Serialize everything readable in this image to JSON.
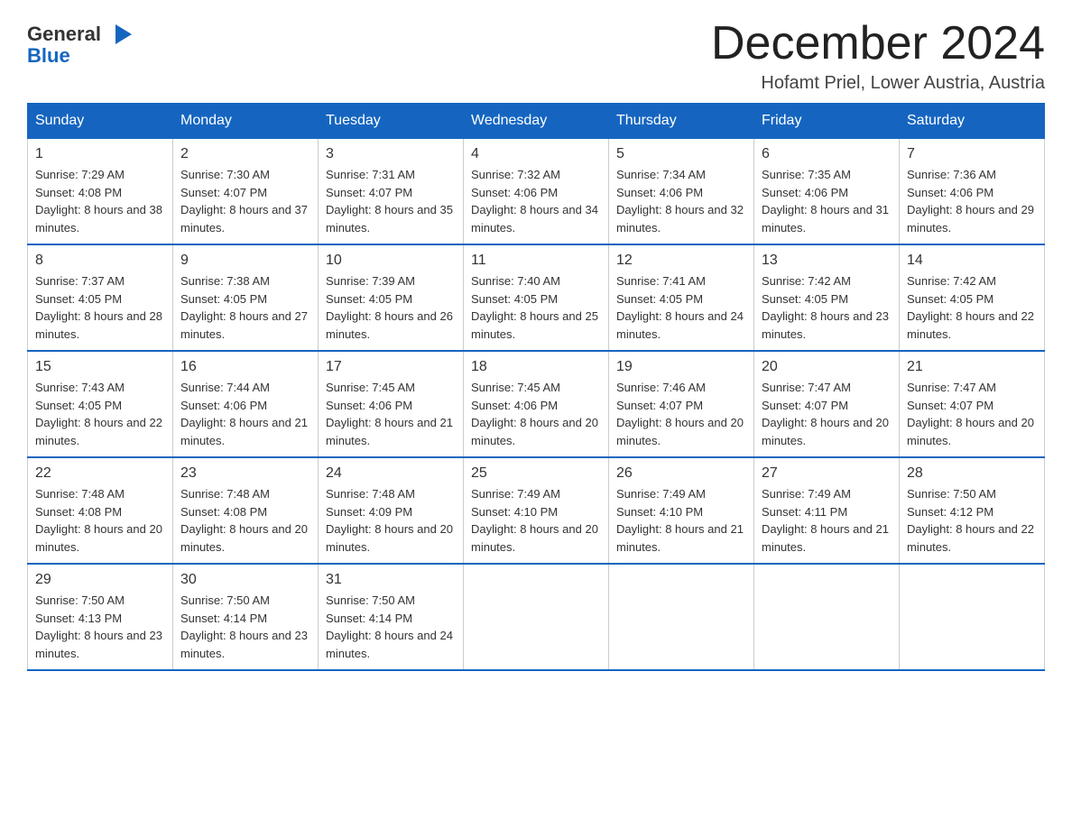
{
  "header": {
    "logo_line1": "General",
    "logo_line2": "Blue",
    "month_title": "December 2024",
    "location": "Hofamt Priel, Lower Austria, Austria"
  },
  "days_of_week": [
    "Sunday",
    "Monday",
    "Tuesday",
    "Wednesday",
    "Thursday",
    "Friday",
    "Saturday"
  ],
  "weeks": [
    [
      {
        "day": "1",
        "sunrise": "7:29 AM",
        "sunset": "4:08 PM",
        "daylight": "8 hours and 38 minutes."
      },
      {
        "day": "2",
        "sunrise": "7:30 AM",
        "sunset": "4:07 PM",
        "daylight": "8 hours and 37 minutes."
      },
      {
        "day": "3",
        "sunrise": "7:31 AM",
        "sunset": "4:07 PM",
        "daylight": "8 hours and 35 minutes."
      },
      {
        "day": "4",
        "sunrise": "7:32 AM",
        "sunset": "4:06 PM",
        "daylight": "8 hours and 34 minutes."
      },
      {
        "day": "5",
        "sunrise": "7:34 AM",
        "sunset": "4:06 PM",
        "daylight": "8 hours and 32 minutes."
      },
      {
        "day": "6",
        "sunrise": "7:35 AM",
        "sunset": "4:06 PM",
        "daylight": "8 hours and 31 minutes."
      },
      {
        "day": "7",
        "sunrise": "7:36 AM",
        "sunset": "4:06 PM",
        "daylight": "8 hours and 29 minutes."
      }
    ],
    [
      {
        "day": "8",
        "sunrise": "7:37 AM",
        "sunset": "4:05 PM",
        "daylight": "8 hours and 28 minutes."
      },
      {
        "day": "9",
        "sunrise": "7:38 AM",
        "sunset": "4:05 PM",
        "daylight": "8 hours and 27 minutes."
      },
      {
        "day": "10",
        "sunrise": "7:39 AM",
        "sunset": "4:05 PM",
        "daylight": "8 hours and 26 minutes."
      },
      {
        "day": "11",
        "sunrise": "7:40 AM",
        "sunset": "4:05 PM",
        "daylight": "8 hours and 25 minutes."
      },
      {
        "day": "12",
        "sunrise": "7:41 AM",
        "sunset": "4:05 PM",
        "daylight": "8 hours and 24 minutes."
      },
      {
        "day": "13",
        "sunrise": "7:42 AM",
        "sunset": "4:05 PM",
        "daylight": "8 hours and 23 minutes."
      },
      {
        "day": "14",
        "sunrise": "7:42 AM",
        "sunset": "4:05 PM",
        "daylight": "8 hours and 22 minutes."
      }
    ],
    [
      {
        "day": "15",
        "sunrise": "7:43 AM",
        "sunset": "4:05 PM",
        "daylight": "8 hours and 22 minutes."
      },
      {
        "day": "16",
        "sunrise": "7:44 AM",
        "sunset": "4:06 PM",
        "daylight": "8 hours and 21 minutes."
      },
      {
        "day": "17",
        "sunrise": "7:45 AM",
        "sunset": "4:06 PM",
        "daylight": "8 hours and 21 minutes."
      },
      {
        "day": "18",
        "sunrise": "7:45 AM",
        "sunset": "4:06 PM",
        "daylight": "8 hours and 20 minutes."
      },
      {
        "day": "19",
        "sunrise": "7:46 AM",
        "sunset": "4:07 PM",
        "daylight": "8 hours and 20 minutes."
      },
      {
        "day": "20",
        "sunrise": "7:47 AM",
        "sunset": "4:07 PM",
        "daylight": "8 hours and 20 minutes."
      },
      {
        "day": "21",
        "sunrise": "7:47 AM",
        "sunset": "4:07 PM",
        "daylight": "8 hours and 20 minutes."
      }
    ],
    [
      {
        "day": "22",
        "sunrise": "7:48 AM",
        "sunset": "4:08 PM",
        "daylight": "8 hours and 20 minutes."
      },
      {
        "day": "23",
        "sunrise": "7:48 AM",
        "sunset": "4:08 PM",
        "daylight": "8 hours and 20 minutes."
      },
      {
        "day": "24",
        "sunrise": "7:48 AM",
        "sunset": "4:09 PM",
        "daylight": "8 hours and 20 minutes."
      },
      {
        "day": "25",
        "sunrise": "7:49 AM",
        "sunset": "4:10 PM",
        "daylight": "8 hours and 20 minutes."
      },
      {
        "day": "26",
        "sunrise": "7:49 AM",
        "sunset": "4:10 PM",
        "daylight": "8 hours and 21 minutes."
      },
      {
        "day": "27",
        "sunrise": "7:49 AM",
        "sunset": "4:11 PM",
        "daylight": "8 hours and 21 minutes."
      },
      {
        "day": "28",
        "sunrise": "7:50 AM",
        "sunset": "4:12 PM",
        "daylight": "8 hours and 22 minutes."
      }
    ],
    [
      {
        "day": "29",
        "sunrise": "7:50 AM",
        "sunset": "4:13 PM",
        "daylight": "8 hours and 23 minutes."
      },
      {
        "day": "30",
        "sunrise": "7:50 AM",
        "sunset": "4:14 PM",
        "daylight": "8 hours and 23 minutes."
      },
      {
        "day": "31",
        "sunrise": "7:50 AM",
        "sunset": "4:14 PM",
        "daylight": "8 hours and 24 minutes."
      },
      null,
      null,
      null,
      null
    ]
  ],
  "labels": {
    "sunrise": "Sunrise:",
    "sunset": "Sunset:",
    "daylight": "Daylight:"
  }
}
